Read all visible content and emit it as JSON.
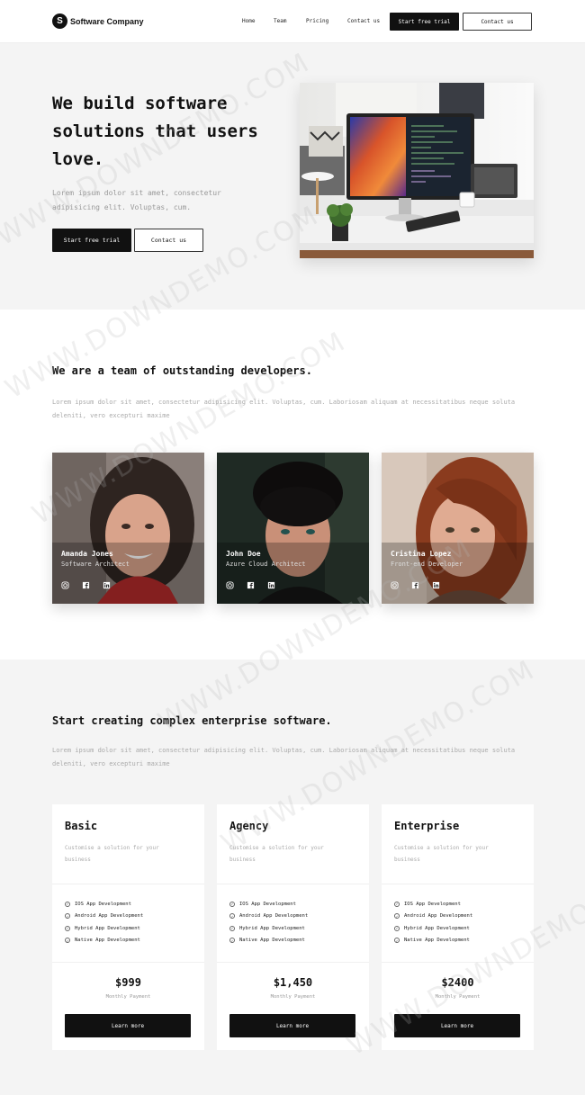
{
  "header": {
    "logo_letter": "S",
    "brand": "Software Company",
    "nav": [
      "Home",
      "Team",
      "Pricing",
      "Contact us"
    ],
    "cta_primary": "Start free trial",
    "cta_secondary": "Contact us"
  },
  "hero": {
    "title": "We build software solutions that users love.",
    "text": "Lorem ipsum dolor sit amet, consectetur adipisicing elit. Voluptas, cum.",
    "cta_primary": "Start free trial",
    "cta_secondary": "Contact us"
  },
  "team": {
    "title": "We are a team of outstanding developers.",
    "text": "Lorem ipsum dolor sit amet, consectetur adipisicing elit. Voluptas, cum. Laboriosam aliquam at necessitatibus neque soluta deleniti, vero excepturi maxime",
    "members": [
      {
        "name": "Amanda Jones",
        "role": "Software Architect"
      },
      {
        "name": "John Doe",
        "role": "Azure Cloud Architect"
      },
      {
        "name": "Cristina Lopez",
        "role": "Front-end Developer"
      }
    ],
    "social_icons": [
      "instagram-icon",
      "facebook-icon",
      "linkedin-icon"
    ]
  },
  "pricing": {
    "title": "Start creating complex enterprise software.",
    "text": "Lorem ipsum dolor sit amet, consectetur adipisicing elit. Voluptas, cum. Laboriosam aliquam at necessitatibus neque soluta deleniti, vero excepturi maxime",
    "plans": [
      {
        "name": "Basic",
        "desc": "Customise a solution for your business",
        "features": [
          "IOS App Development",
          "Android App Development",
          "Hybrid App Development",
          "Native App Development"
        ],
        "price": "$999",
        "period": "Monthly Payment",
        "cta": "Learn more"
      },
      {
        "name": "Agency",
        "desc": "Customise a solution for your business",
        "features": [
          "IOS App Development",
          "Android App Development",
          "Hybrid App Development",
          "Native App Development"
        ],
        "price": "$1,450",
        "period": "Monthly Payment",
        "cta": "Learn more"
      },
      {
        "name": "Enterprise",
        "desc": "Customise a solution for your business",
        "features": [
          "IOS App Development",
          "Android App Development",
          "Hybrid App Development",
          "Native App Development"
        ],
        "price": "$2400",
        "period": "Monthly Payment",
        "cta": "Learn more"
      }
    ]
  },
  "watermark": "WWW.DOWNDEMO.COM",
  "colors": {
    "dark": "#111111",
    "section_bg": "#f4f4f4",
    "muted_text": "#999999"
  }
}
